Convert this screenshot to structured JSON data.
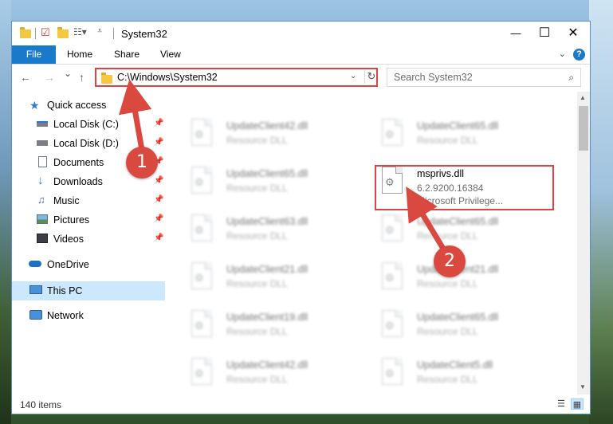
{
  "window": {
    "title": "System32",
    "minimize": "—",
    "maximize": "☐",
    "close": "✕"
  },
  "ribbon": {
    "tabs": [
      "File",
      "Home",
      "Share",
      "View"
    ],
    "help": "?"
  },
  "address": {
    "path": "C:\\Windows\\System32",
    "refresh_glyph": "↻",
    "search_placeholder": "Search System32",
    "search_glyph": "⌕"
  },
  "nav": {
    "back": "←",
    "forward": "→",
    "recent": "⌄",
    "up": "↑"
  },
  "sidebar": {
    "items": [
      {
        "label": "Quick access",
        "icon": "star-icon",
        "pinned": false
      },
      {
        "label": "Local Disk (C:)",
        "icon": "drive-icon",
        "pinned": true
      },
      {
        "label": "Local Disk (D:)",
        "icon": "drive-icon",
        "pinned": true
      },
      {
        "label": "Documents",
        "icon": "documents-icon",
        "pinned": true
      },
      {
        "label": "Downloads",
        "icon": "download-icon",
        "pinned": true
      },
      {
        "label": "Music",
        "icon": "music-icon",
        "pinned": true
      },
      {
        "label": "Pictures",
        "icon": "pictures-icon",
        "pinned": true
      },
      {
        "label": "Videos",
        "icon": "videos-icon",
        "pinned": true
      },
      {
        "label": "OneDrive",
        "icon": "cloud-icon",
        "pinned": false
      },
      {
        "label": "This PC",
        "icon": "computer-icon",
        "pinned": false
      },
      {
        "label": "Network",
        "icon": "network-icon",
        "pinned": false
      }
    ]
  },
  "files": {
    "left_column": [
      {
        "name": "UpdateClient42.dll",
        "type": "Resource DLL"
      },
      {
        "name": "UpdateClient65.dll",
        "type": "Resource DLL"
      },
      {
        "name": "UpdateClient63.dll",
        "type": "Resource DLL"
      },
      {
        "name": "UpdateClient21.dll",
        "type": "Resource DLL"
      },
      {
        "name": "UpdateClient19.dll",
        "type": "Resource DLL"
      },
      {
        "name": "UpdateClient42.dll",
        "type": "Resource DLL"
      }
    ],
    "right_column": [
      {
        "name": "UpdateClient65.dll",
        "type": "Resource DLL"
      },
      {
        "name": "UpdateClient65.dll",
        "type": "Resource DLL"
      },
      {
        "name": "UpdateClient21.dll",
        "type": "Resource DLL"
      },
      {
        "name": "UpdateClient65.dll",
        "type": "Resource DLL"
      },
      {
        "name": "UpdateClient5.dll",
        "type": "Resource DLL"
      }
    ],
    "highlighted": {
      "name": "msprivs.dll",
      "version": "6.2.9200.16384",
      "description": "Microsoft Privilege..."
    }
  },
  "status": {
    "item_count": "140 items"
  },
  "annotations": {
    "step1": "1",
    "step2": "2"
  },
  "colors": {
    "accent": "#1979ca",
    "highlight_red": "#d94545",
    "badge_red": "#d9493f",
    "selection": "#cce8ff"
  }
}
